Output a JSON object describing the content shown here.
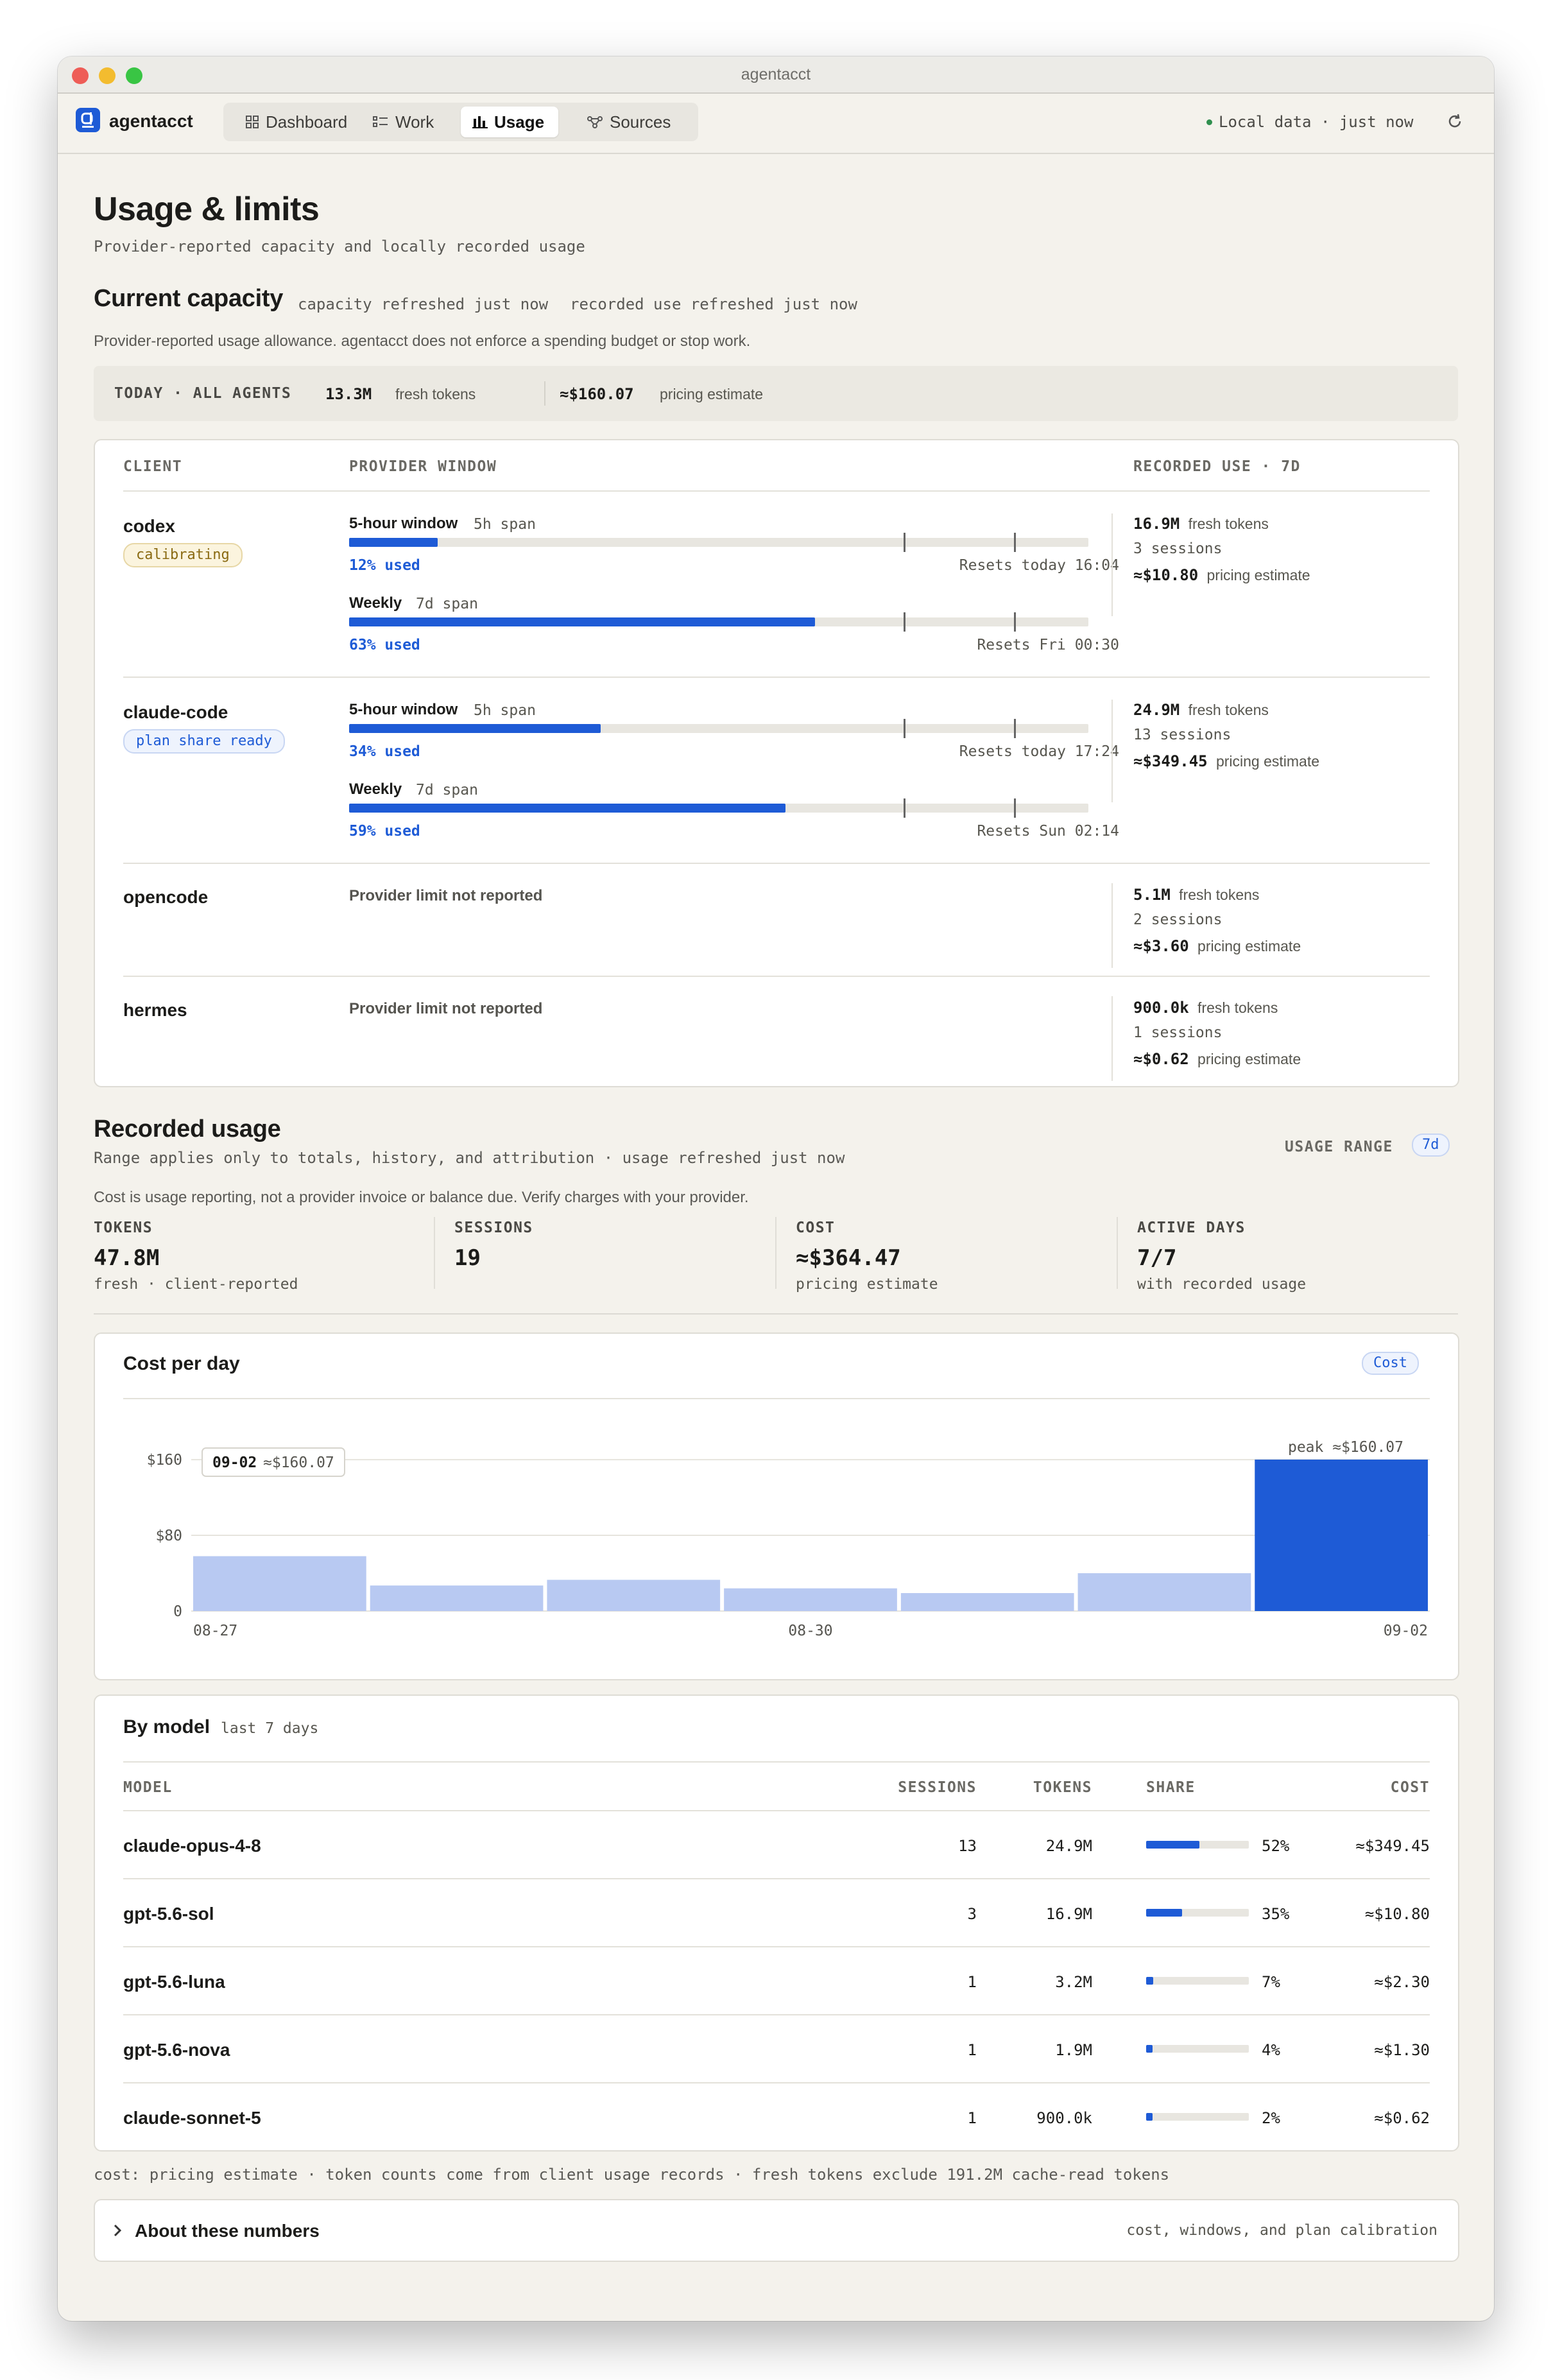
{
  "window": {
    "title": "agentacct"
  },
  "app": {
    "brand": "agentacct",
    "nav": [
      {
        "label": "Dashboard",
        "icon": "grid-icon"
      },
      {
        "label": "Work",
        "icon": "list-icon"
      },
      {
        "label": "Usage",
        "icon": "bar-chart-icon",
        "active": true
      },
      {
        "label": "Sources",
        "icon": "nodes-icon"
      }
    ],
    "status": "Local data · just now"
  },
  "page": {
    "title": "Usage & limits",
    "subtitle": "Provider-reported capacity and locally recorded usage"
  },
  "capacity": {
    "title": "Current capacity",
    "refresh_capacity": "capacity refreshed just now",
    "refresh_recorded": "recorded use refreshed just now",
    "note": "Provider-reported usage allowance. agentacct does not enforce a spending budget or stop work.",
    "today": {
      "label": "TODAY · ALL AGENTS",
      "tokens": "13.3M",
      "tokens_label": "fresh tokens",
      "cost": "≈$160.07",
      "cost_label": "pricing estimate"
    },
    "headers": {
      "client": "CLIENT",
      "window": "PROVIDER WINDOW",
      "recorded": "RECORDED USE · 7D"
    },
    "clients": [
      {
        "name": "codex",
        "badge": "calibrating",
        "windows": [
          {
            "name": "5-hour window",
            "span": "5h span",
            "used": "12% used",
            "pct": 12,
            "reset": "Resets today 16:04"
          },
          {
            "name": "Weekly",
            "span": "7d span",
            "used": "63% used",
            "pct": 63,
            "reset": "Resets Fri 00:30"
          }
        ],
        "tokens": "16.9M",
        "tokens_label": "fresh tokens",
        "sessions": "3 sessions",
        "cost": "≈$10.80",
        "cost_label": "pricing estimate"
      },
      {
        "name": "claude-code",
        "badge": "plan share ready",
        "windows": [
          {
            "name": "5-hour window",
            "span": "5h span",
            "used": "34% used",
            "pct": 34,
            "reset": "Resets today 17:24"
          },
          {
            "name": "Weekly",
            "span": "7d span",
            "used": "59% used",
            "pct": 59,
            "reset": "Resets Sun 02:14"
          }
        ],
        "tokens": "24.9M",
        "tokens_label": "fresh tokens",
        "sessions": "13 sessions",
        "cost": "≈$349.45",
        "cost_label": "pricing estimate"
      },
      {
        "name": "opencode",
        "limit": "Provider limit not reported",
        "tokens": "5.1M",
        "tokens_label": "fresh tokens",
        "sessions": "2 sessions",
        "cost": "≈$3.60",
        "cost_label": "pricing estimate"
      },
      {
        "name": "hermes",
        "limit": "Provider limit not reported",
        "tokens": "900.0k",
        "tokens_label": "fresh tokens",
        "sessions": "1 sessions",
        "cost": "≈$0.62",
        "cost_label": "pricing estimate"
      }
    ]
  },
  "recorded": {
    "title": "Recorded usage",
    "subtitle": "Range applies only to totals, history, and attribution · usage refreshed just now",
    "range_label": "USAGE RANGE",
    "range_value": "7d",
    "note": "Cost is usage reporting, not a provider invoice or balance due. Verify charges with your provider.",
    "stats": [
      {
        "label": "TOKENS",
        "value": "47.8M",
        "sub": "fresh · client-reported"
      },
      {
        "label": "SESSIONS",
        "value": "19",
        "sub": ""
      },
      {
        "label": "COST",
        "value": "≈$364.47",
        "sub": "pricing estimate"
      },
      {
        "label": "ACTIVE DAYS",
        "value": "7/7",
        "sub": "with recorded usage"
      }
    ]
  },
  "cost_chart": {
    "title": "Cost per day",
    "toggle": "Cost",
    "tooltip_date": "09-02",
    "tooltip_value": "≈$160.07",
    "peak_label": "peak ≈$160.07"
  },
  "chart_data": {
    "type": "bar",
    "title": "Cost per day",
    "categories": [
      "08-27",
      "08-28",
      "08-29",
      "08-30",
      "08-31",
      "09-01",
      "09-02"
    ],
    "values": [
      58,
      27,
      33,
      24,
      19,
      40,
      160.07
    ],
    "x_tick_labels": [
      "08-27",
      "08-30",
      "09-02"
    ],
    "y_ticks": [
      0,
      80,
      160
    ],
    "y_tick_labels": [
      "0",
      "$80",
      "$160"
    ],
    "ylim": [
      0,
      160.07
    ],
    "highlight_index": 6,
    "colors": {
      "normal": "#b8c9f2",
      "highlight": "#1e5bd6"
    }
  },
  "by_model": {
    "title": "By model",
    "range": "last 7 days",
    "headers": {
      "model": "MODEL",
      "sessions": "SESSIONS",
      "tokens": "TOKENS",
      "share": "SHARE",
      "cost": "COST"
    },
    "rows": [
      {
        "model": "claude-opus-4-8",
        "sessions": "13",
        "tokens": "24.9M",
        "share": "52%",
        "share_pct": 52,
        "cost": "≈$349.45"
      },
      {
        "model": "gpt-5.6-sol",
        "sessions": "3",
        "tokens": "16.9M",
        "share": "35%",
        "share_pct": 35,
        "cost": "≈$10.80"
      },
      {
        "model": "gpt-5.6-luna",
        "sessions": "1",
        "tokens": "3.2M",
        "share": "7%",
        "share_pct": 7,
        "cost": "≈$2.30"
      },
      {
        "model": "gpt-5.6-nova",
        "sessions": "1",
        "tokens": "1.9M",
        "share": "4%",
        "share_pct": 4,
        "cost": "≈$1.30"
      },
      {
        "model": "claude-sonnet-5",
        "sessions": "1",
        "tokens": "900.0k",
        "share": "2%",
        "share_pct": 2,
        "cost": "≈$0.62"
      }
    ]
  },
  "footnote": "cost: pricing estimate · token counts come from client usage records · fresh tokens exclude 191.2M cache-read tokens",
  "about": {
    "title": "About these numbers",
    "hint": "cost, windows, and plan calibration"
  }
}
